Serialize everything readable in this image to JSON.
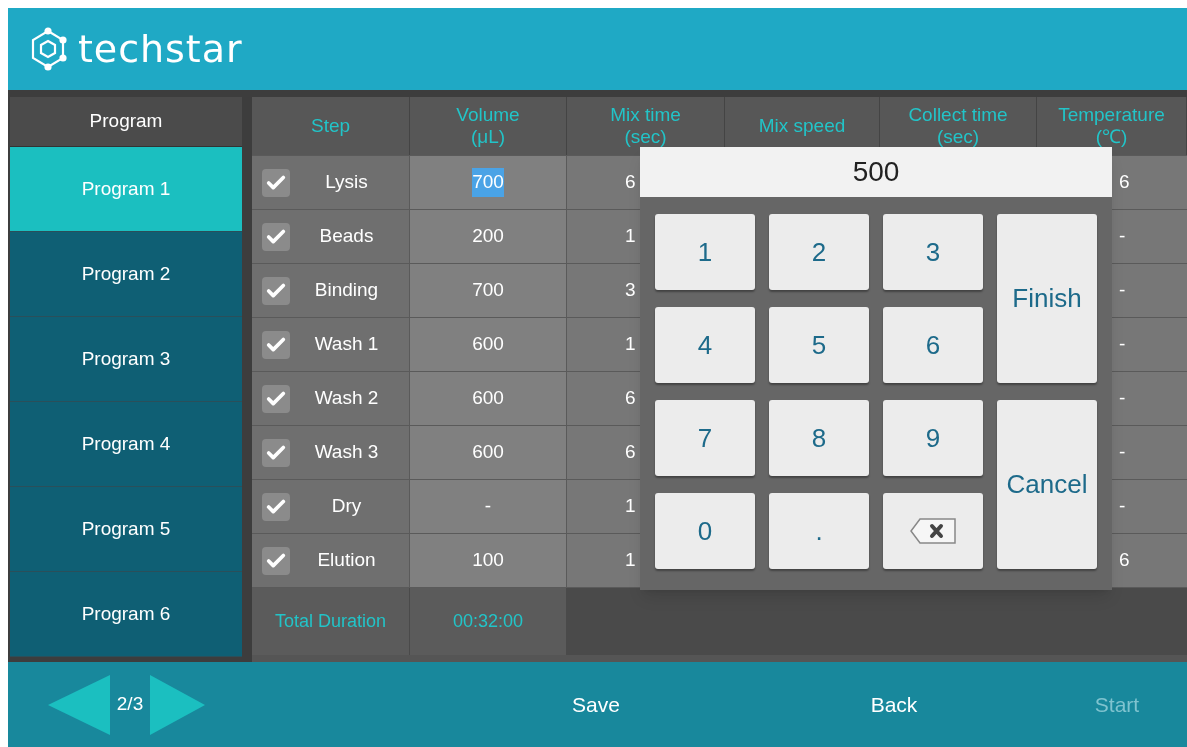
{
  "header": {
    "logo_text": "techstar"
  },
  "sidebar": {
    "title": "Program",
    "items": [
      {
        "label": "Program 1",
        "selected": true
      },
      {
        "label": "Program 2",
        "selected": false
      },
      {
        "label": "Program 3",
        "selected": false
      },
      {
        "label": "Program 4",
        "selected": false
      },
      {
        "label": "Program 5",
        "selected": false
      },
      {
        "label": "Program 6",
        "selected": false
      }
    ]
  },
  "table": {
    "columns": [
      {
        "line1": "Step"
      },
      {
        "line1": "Volume",
        "line2": "(μL)"
      },
      {
        "line1": "Mix time",
        "line2": "(sec)"
      },
      {
        "line1": "Mix speed"
      },
      {
        "line1": "Collect time",
        "line2": "(sec)"
      },
      {
        "line1": "Temperature",
        "line2": "(℃)"
      }
    ],
    "rows": [
      {
        "checked": true,
        "step": "Lysis",
        "volume": "700",
        "volume_highlighted": true,
        "mix_time": "6",
        "temperature": "6"
      },
      {
        "checked": true,
        "step": "Beads",
        "volume": "200",
        "volume_highlighted": false,
        "mix_time": "1",
        "temperature": "-"
      },
      {
        "checked": true,
        "step": "Binding",
        "volume": "700",
        "volume_highlighted": false,
        "mix_time": "3",
        "temperature": "-"
      },
      {
        "checked": true,
        "step": "Wash 1",
        "volume": "600",
        "volume_highlighted": false,
        "mix_time": "1",
        "temperature": "-"
      },
      {
        "checked": true,
        "step": "Wash 2",
        "volume": "600",
        "volume_highlighted": false,
        "mix_time": "6",
        "temperature": "-"
      },
      {
        "checked": true,
        "step": "Wash 3",
        "volume": "600",
        "volume_highlighted": false,
        "mix_time": "6",
        "temperature": "-"
      },
      {
        "checked": true,
        "step": "Dry",
        "volume": "-",
        "volume_highlighted": false,
        "mix_time": "1",
        "temperature": "-"
      },
      {
        "checked": true,
        "step": "Elution",
        "volume": "100",
        "volume_highlighted": false,
        "mix_time": "1",
        "temperature": "6"
      }
    ],
    "total": {
      "label": "Total Duration",
      "value": "00:32:00"
    }
  },
  "keypad": {
    "display": "500",
    "keys": [
      {
        "kind": "digit",
        "label": "1"
      },
      {
        "kind": "digit",
        "label": "2"
      },
      {
        "kind": "digit",
        "label": "3"
      },
      {
        "kind": "action",
        "label": "Finish"
      },
      {
        "kind": "digit",
        "label": "4"
      },
      {
        "kind": "digit",
        "label": "5"
      },
      {
        "kind": "digit",
        "label": "6"
      },
      {
        "kind": "digit",
        "label": "7"
      },
      {
        "kind": "digit",
        "label": "8"
      },
      {
        "kind": "digit",
        "label": "9"
      },
      {
        "kind": "action",
        "label": "Cancel"
      },
      {
        "kind": "digit",
        "label": "0"
      },
      {
        "kind": "digit",
        "label": "."
      },
      {
        "kind": "backspace"
      }
    ]
  },
  "footer": {
    "page": "2/3",
    "buttons": [
      {
        "label": "Save",
        "disabled": false
      },
      {
        "label": "Back",
        "disabled": false
      },
      {
        "label": "Start",
        "disabled": true
      }
    ]
  }
}
